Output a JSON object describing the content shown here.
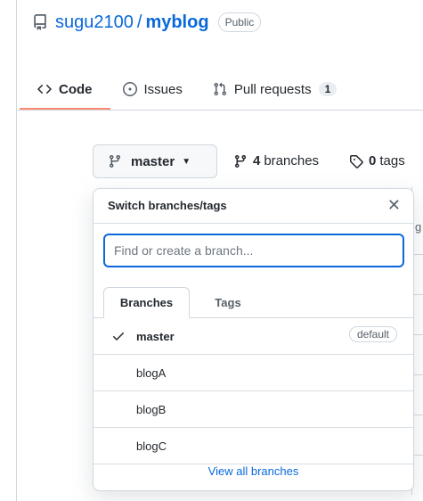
{
  "header": {
    "owner": "sugu2100",
    "separator": "/",
    "repo": "myblog",
    "visibility": "Public"
  },
  "tabs": [
    {
      "label": "Code",
      "icon": "code-icon",
      "active": true
    },
    {
      "label": "Issues",
      "icon": "issue-opened-icon",
      "active": false
    },
    {
      "label": "Pull requests",
      "icon": "git-pull-request-icon",
      "active": false,
      "count": "1"
    }
  ],
  "toolbar": {
    "branch": "master",
    "branches_count": "4",
    "branches_label": "branches",
    "tags_count": "0",
    "tags_label": "tags"
  },
  "dropdown": {
    "title": "Switch branches/tags",
    "filter_placeholder": "Find or create a branch...",
    "tabs": [
      "Branches",
      "Tags"
    ],
    "branches": [
      {
        "name": "master",
        "selected": true,
        "badge": "default"
      },
      {
        "name": "blogA"
      },
      {
        "name": "blogB"
      },
      {
        "name": "blogC"
      }
    ],
    "view_all": "View all branches"
  },
  "background": {
    "partial_letter": "g"
  },
  "colors": {
    "link": "#0969da",
    "active_tab_underline": "#fd8c73",
    "border": "#d0d7de"
  }
}
